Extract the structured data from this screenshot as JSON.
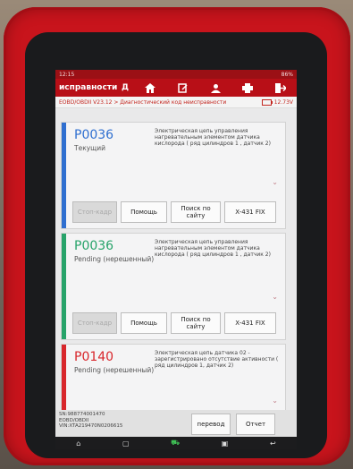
{
  "status": {
    "time": "12:15",
    "right": "86%"
  },
  "topbar": {
    "title": "исправности",
    "d_label": "Д"
  },
  "breadcrumb": {
    "path": "EOBD/OBDII V23.12 > Диагностический код неисправности",
    "voltage": "12.73V"
  },
  "cards": [
    {
      "code": "P0036",
      "status": "Текущий",
      "description": "Электрическая цепь управления нагревательным элементом датчика кислорода ( ряд цилиндров 1 , датчик 2)",
      "stripe_color": "#2f6fd0",
      "code_color": "#2f6fd0",
      "buttons": [
        "Стоп-кадр",
        "Помощь",
        "Поиск по сайту",
        "X-431 FIX"
      ]
    },
    {
      "code": "P0036",
      "status": "Pending (нерешенный)",
      "description": "Электрическая цепь управления нагревательным элементом датчика кислорода ( ряд цилиндров 1 , датчик 2)",
      "stripe_color": "#27a36a",
      "code_color": "#27a36a",
      "buttons": [
        "Стоп-кадр",
        "Помощь",
        "Поиск по сайту",
        "X-431 FIX"
      ]
    },
    {
      "code": "P0140",
      "status": "Pending (нерешенный)",
      "description": "Электрическая цепь датчика 02 - зарегистрировано отсутствие активности ( ряд цилиндров 1, датчик 2)",
      "stripe_color": "#d8262b",
      "code_color": "#d8262b",
      "buttons": []
    }
  ],
  "bottom": {
    "sn": "SN:988774001470",
    "protocol": "EOBD/OBDII",
    "vin": "VIN:XTA219470N0206615",
    "translate_label": "перевод",
    "report_label": "Отчет"
  }
}
